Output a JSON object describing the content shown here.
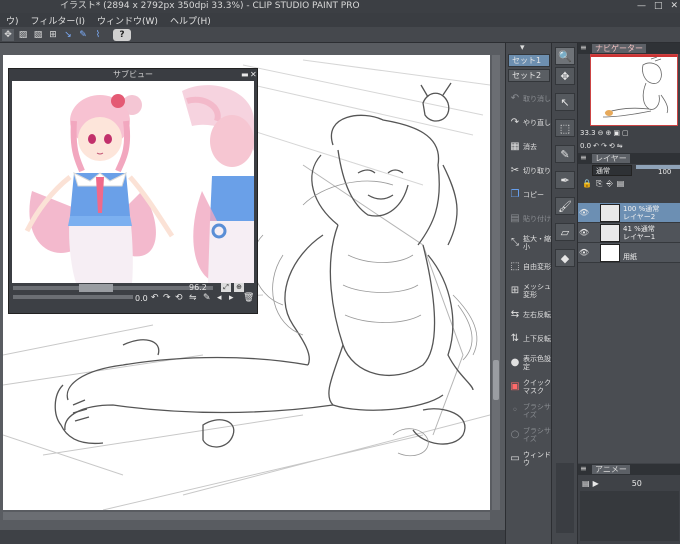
{
  "titlebar": {
    "title": "イラスト* (2894 x 2792px 350dpi 33.3%) - CLIP STUDIO PAINT PRO",
    "minimize": "—",
    "maximize": "□",
    "close": "✕"
  },
  "menubar": {
    "items": [
      "ウ)",
      "フィルター(I)",
      "ウィンドウ(W)",
      "ヘルプ(H)"
    ]
  },
  "toolbar": {
    "help_label": "?"
  },
  "subview": {
    "title": "サブビュー",
    "zoom": "96.2",
    "angle": "0.0"
  },
  "command_bar": {
    "sets": [
      "セット1",
      "セット2"
    ],
    "commands": [
      {
        "label": "取り消し",
        "icon": "undo-icon",
        "enabled": false
      },
      {
        "label": "やり直し",
        "icon": "redo-icon",
        "enabled": true
      },
      {
        "label": "消去",
        "icon": "clear-icon",
        "enabled": true
      },
      {
        "label": "切り取り",
        "icon": "cut-icon",
        "enabled": true
      },
      {
        "label": "コピー",
        "icon": "copy-icon",
        "enabled": true
      },
      {
        "label": "貼り付け",
        "icon": "paste-icon",
        "enabled": false
      },
      {
        "label": "拡大・縮小",
        "icon": "scale-icon",
        "enabled": true
      },
      {
        "label": "自由変形",
        "icon": "free-transform-icon",
        "enabled": true
      },
      {
        "label": "メッシュ変形",
        "icon": "mesh-transform-icon",
        "enabled": true
      },
      {
        "label": "左右反転",
        "icon": "flip-horizontal-icon",
        "enabled": true
      },
      {
        "label": "上下反転",
        "icon": "flip-vertical-icon",
        "enabled": true
      },
      {
        "label": "表示色設定",
        "icon": "display-color-icon",
        "enabled": true
      },
      {
        "label": "クイックマスク",
        "icon": "quick-mask-icon",
        "enabled": true
      },
      {
        "label": "ブラシサイズ",
        "icon": "brush-size-icon",
        "enabled": false
      },
      {
        "label": "ブラシサイズ",
        "icon": "brush-size-icon",
        "enabled": false
      },
      {
        "label": "ウィンドウ",
        "icon": "window-icon",
        "enabled": true
      }
    ]
  },
  "navigator": {
    "title": "ナビゲーター",
    "zoom": "33.3",
    "angle": "0.0"
  },
  "layers_panel": {
    "tab": "レイヤー",
    "blend_mode": "通常",
    "opacity": "100",
    "layers": [
      {
        "line1": "100 %通常",
        "line2": "レイヤー2",
        "selected": true
      },
      {
        "line1": "41 %通常",
        "line2": "レイヤー1",
        "selected": false
      },
      {
        "line1": "",
        "line2": "用紙",
        "selected": false
      }
    ]
  },
  "animation_panel": {
    "tab": "アニメー",
    "frame": "50"
  },
  "colors": {
    "selected_layer": "#6c8fb3",
    "active_set": "#6d8fb0"
  }
}
